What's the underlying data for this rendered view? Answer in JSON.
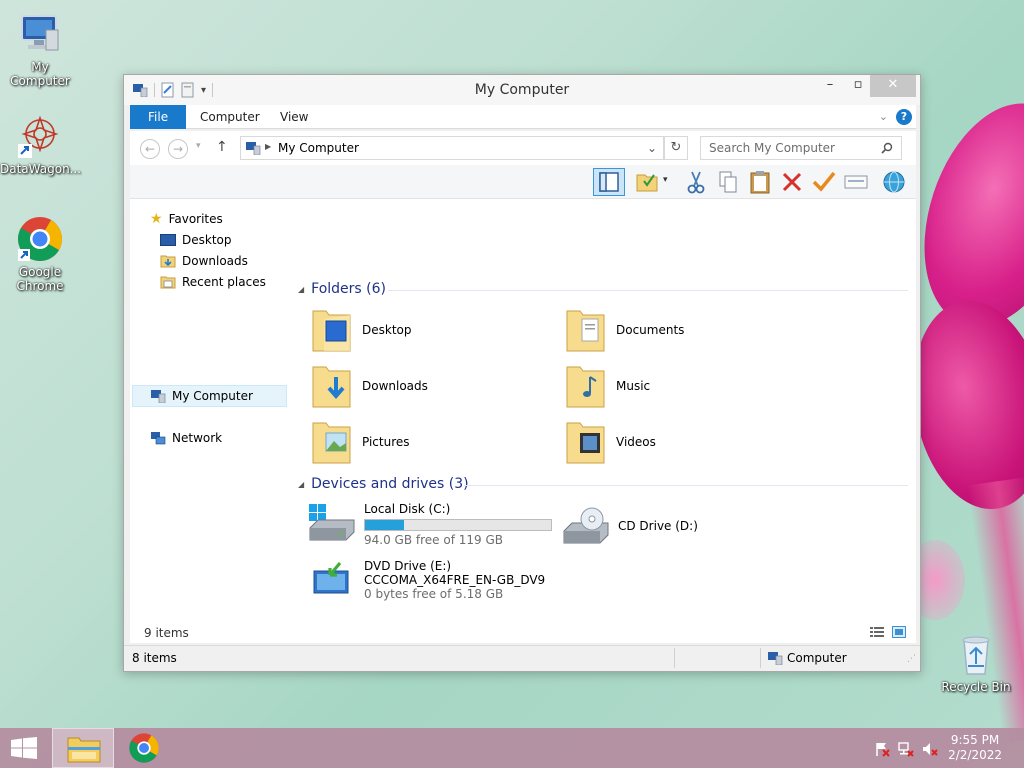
{
  "desktop": {
    "icons": [
      {
        "label": "My Computer"
      },
      {
        "label": "DataWagon..."
      },
      {
        "label": "Google Chrome"
      },
      {
        "label": "Recycle Bin"
      }
    ]
  },
  "window": {
    "title": "My Computer",
    "tabs": [
      "File",
      "Computer",
      "View"
    ],
    "address": "My Computer",
    "search_placeholder": "Search My Computer",
    "nav": {
      "favorites": "Favorites",
      "desktop": "Desktop",
      "downloads": "Downloads",
      "recent": "Recent places",
      "my_computer": "My Computer",
      "network": "Network"
    },
    "folders_header": "Folders (6)",
    "folders": [
      {
        "name": "Desktop",
        "icon": "desktop-folder-icon"
      },
      {
        "name": "Documents",
        "icon": "documents-folder-icon"
      },
      {
        "name": "Downloads",
        "icon": "downloads-folder-icon"
      },
      {
        "name": "Music",
        "icon": "music-folder-icon"
      },
      {
        "name": "Pictures",
        "icon": "pictures-folder-icon"
      },
      {
        "name": "Videos",
        "icon": "videos-folder-icon"
      }
    ],
    "devices_header": "Devices and drives (3)",
    "drives": [
      {
        "name": "Local Disk (C:)",
        "free": "94.0 GB free of 119 GB",
        "used_fraction": 0.21
      },
      {
        "name": "CD Drive (D:)"
      },
      {
        "name": "DVD Drive (E:)",
        "volume": "CCCOMA_X64FRE_EN-GB_DV9",
        "free": "0 bytes free of 5.18 GB"
      }
    ],
    "inner_status": "9 items",
    "status_items": "8 items",
    "status_location": "Computer"
  },
  "taskbar": {
    "time": "9:55 PM",
    "date": "2/2/2022"
  },
  "colors": {
    "accent": "#1979ca",
    "group_header": "#1e3287",
    "progress": "#26a0da"
  }
}
